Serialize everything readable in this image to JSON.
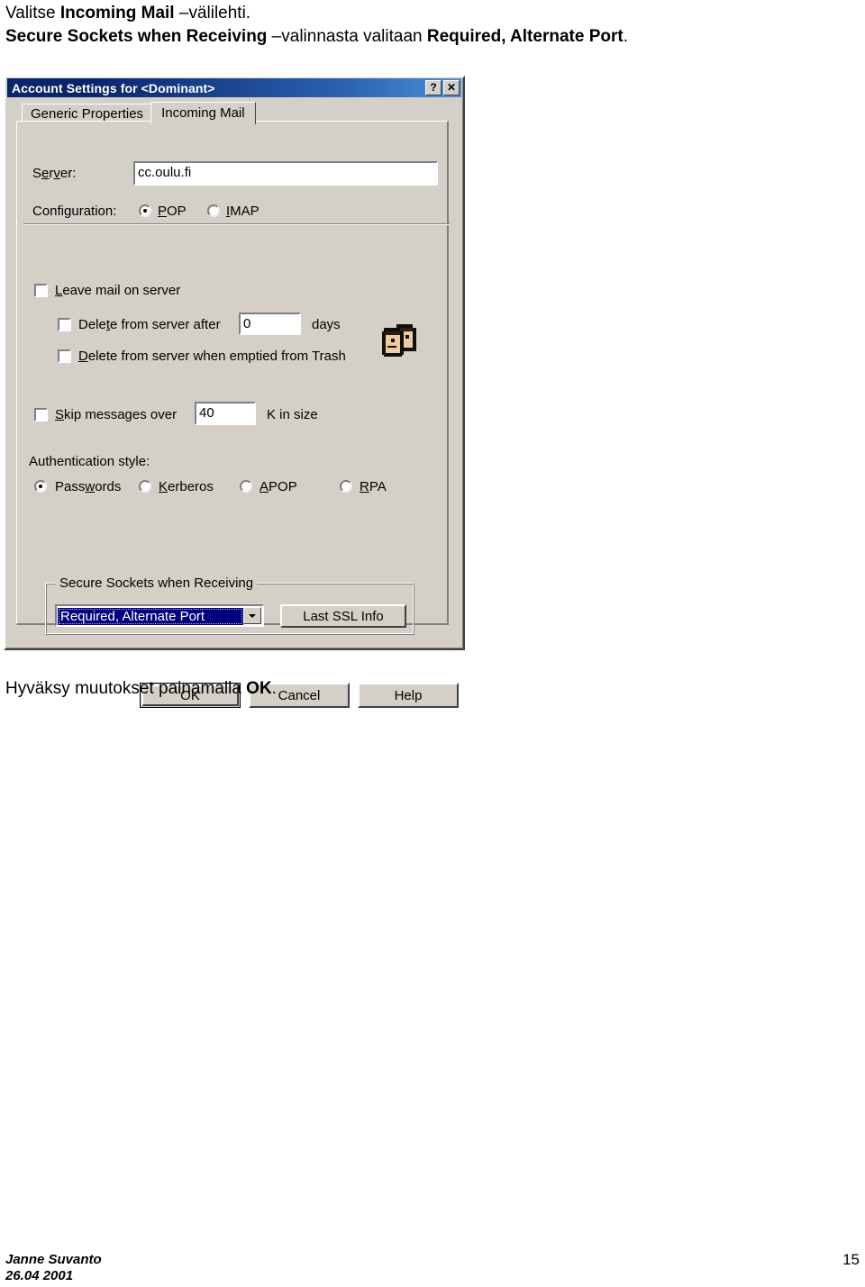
{
  "document": {
    "intro_line_1_prefix": "Valitse ",
    "intro_line_1_bold": "Incoming Mail",
    "intro_line_1_suffix": " –välilehti.",
    "intro_line_2_bold_1": "Secure Sockets when Receiving",
    "intro_line_2_mid": " –valinnasta valitaan ",
    "intro_line_2_bold_2": "Required, Alternate Port",
    "intro_line_2_suffix": ".",
    "outro_prefix": "Hyväksy muutokset painamalla ",
    "outro_bold": "OK",
    "outro_suffix": "."
  },
  "dialog": {
    "title": "Account Settings for <Dominant>",
    "title_buttons": {
      "help": "?",
      "close": "✕"
    },
    "tabs": [
      {
        "label": "Generic Properties",
        "active": false
      },
      {
        "label": "Incoming Mail",
        "active": true
      }
    ],
    "fields": {
      "server_label": "Server:",
      "server_value": "cc.oulu.fi",
      "configuration_label": "Configuration:",
      "configuration_options": [
        {
          "label": "POP",
          "selected": true
        },
        {
          "label": "IMAP",
          "selected": false
        }
      ],
      "leave_mail_label": "Leave mail on server",
      "leave_mail_checked": false,
      "delete_after_label": "Delete from server after",
      "delete_after_value": "0",
      "delete_after_unit": "days",
      "delete_after_checked": false,
      "delete_trash_label": "Delete from server when emptied from Trash",
      "delete_trash_checked": false,
      "skip_messages_label": "Skip messages over",
      "skip_messages_value": "40",
      "skip_messages_unit": "K in size",
      "skip_messages_checked": false,
      "auth_style_label": "Authentication style:",
      "auth_options": [
        {
          "label": "Passwords",
          "selected": true
        },
        {
          "label": "Kerberos",
          "selected": false
        },
        {
          "label": "APOP",
          "selected": false
        },
        {
          "label": "RPA",
          "selected": false
        }
      ]
    },
    "ssl_group": {
      "title": "Secure Sockets when Receiving",
      "selected_option": "Required, Alternate Port",
      "last_ssl_info_button": "Last SSL Info"
    },
    "buttons": {
      "ok": "OK",
      "cancel": "Cancel",
      "help": "Help"
    },
    "colors": {
      "titlebar_start": "#0a246a",
      "titlebar_end": "#4a8ed6",
      "face": "#d4d0c8",
      "selection": "#000080"
    }
  },
  "footer": {
    "author": "Janne Suvanto",
    "date": "26.04 2001",
    "page_number": "15"
  }
}
